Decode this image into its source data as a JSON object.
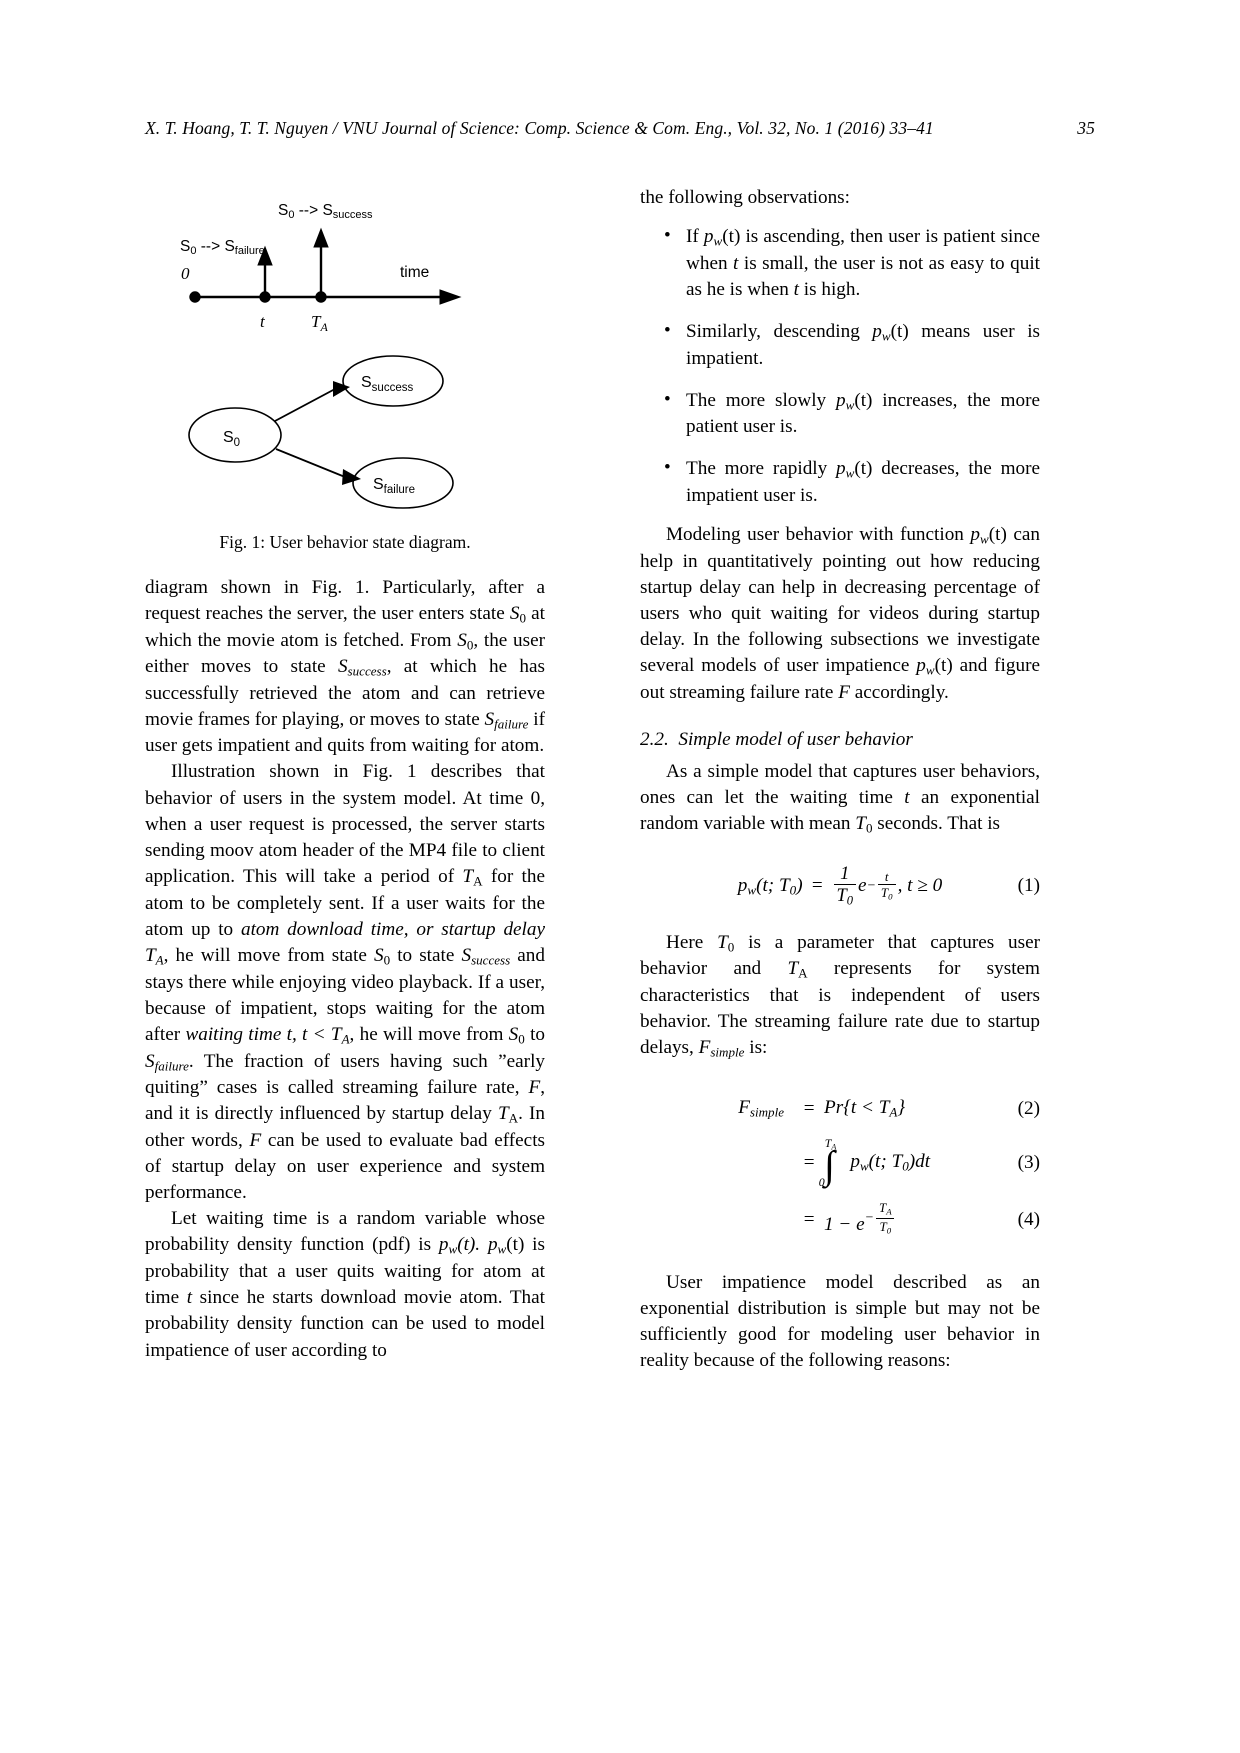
{
  "header": {
    "running_head": "X. T. Hoang, T. T. Nguyen / VNU Journal of Science: Comp. Science & Com. Eng., Vol. 32, No. 1 (2016) 33–41",
    "page_number": "35"
  },
  "figure": {
    "caption": "Fig. 1: User behavior state diagram.",
    "timeline": {
      "label_success": "S₀ --> S",
      "label_success_sub": "success",
      "label_failure": "S₀ --> S",
      "label_failure_sub": "failure",
      "origin_label": "0",
      "axis_label": "time",
      "tick_t": "t",
      "tick_ta": "T",
      "tick_ta_sub": "A"
    },
    "states": {
      "start": "S",
      "start_sub": "0",
      "success": "S",
      "success_sub": "success",
      "failure": "S",
      "failure_sub": "failure"
    }
  },
  "left_column": {
    "para1": {
      "part1": "diagram shown in Fig. 1. Particularly, after a request reaches the server, the user enters state ",
      "sym_s0_a": "S",
      "sub_0_a": "0",
      "part2": " at which the movie atom is fetched. From ",
      "sym_s0_b": "S",
      "sub_0_b": "0",
      "part3": ", the user either moves to state ",
      "sym_ssuccess": "S",
      "sub_success": "success",
      "part4": ", at which he has successfully retrieved the atom and can retrieve movie frames for playing, or moves to state ",
      "sym_sfailure": "S",
      "sub_failure": "failure",
      "part5": " if user gets impatient and quits from waiting for atom."
    },
    "para2": {
      "part1": "Illustration shown in Fig. 1 describes that behavior of users in the system model. At time 0, when a user request is processed, the server starts sending moov atom header of the MP4 file to client application. This will take a period of ",
      "sym_ta_a": "T",
      "sub_a_a": "A",
      "part2": " for the atom to be completely sent. If a user waits for the atom up to ",
      "em1": "atom download time, or startup delay T",
      "em1_sub": "A",
      "part3": ", he will move from state ",
      "sym_s0_a": "S",
      "sub_0_a": "0",
      "part4": " to state ",
      "sym_ssuccess": "S",
      "sub_success": "success",
      "part5": " and stays there while enjoying video playback. If a user, because of impatient, stops waiting for the atom after ",
      "em2": "waiting time t, t < T",
      "em2_sub": "A",
      "part6": ", he will move from ",
      "sym_s0_b": "S",
      "sub_0_b": "0",
      "part7": " to ",
      "sym_sfailure": "S",
      "sub_failure": "failure",
      "part8": ". The fraction of users having such ”early quiting” cases is called streaming failure rate, ",
      "sym_f_a": "F",
      "part9": ", and it is directly influenced by startup delay ",
      "sym_ta_b": "T",
      "sub_a_b": "A",
      "part10": ". In other words, ",
      "sym_f_b": "F",
      "part11": " can be used to evaluate bad effects of startup delay on user experience and system performance."
    },
    "para3": {
      "part1": "Let waiting time is a random variable whose probability density function (pdf) is ",
      "sym_pw_a": "p",
      "sub_w_a": "w",
      "part2": "(t). ",
      "sym_pw_b": "p",
      "sub_w_b": "w",
      "part3": "(t) is probability that a user quits waiting for atom at time ",
      "sym_t": "t",
      "part4": " since he starts download movie atom. That probability density function can be used to model impatience of user according to"
    }
  },
  "right_column": {
    "lead": "the following observations:",
    "bullet_marker": "•",
    "observations": [
      {
        "part1": "If ",
        "sym_p": "p",
        "sym_sub": "w",
        "part2": "(t) is ascending, then user is patient since when ",
        "sym_t1": "t",
        "part3": " is small, the user is not as easy to quit as he is when ",
        "sym_t2": "t",
        "part4": " is high."
      },
      {
        "part1": "Similarly, descending ",
        "sym_p": "p",
        "sym_sub": "w",
        "part2": "(t) means user is impatient.",
        "sym_t1": "",
        "part3": "",
        "sym_t2": "",
        "part4": ""
      },
      {
        "part1": "The more slowly ",
        "sym_p": "p",
        "sym_sub": "w",
        "part2": "(t) increases, the more patient user is.",
        "sym_t1": "",
        "part3": "",
        "sym_t2": "",
        "part4": ""
      },
      {
        "part1": "The more rapidly ",
        "sym_p": "p",
        "sym_sub": "w",
        "part2": "(t) decreases, the more impatient user is.",
        "sym_t1": "",
        "part3": "",
        "sym_t2": "",
        "part4": ""
      }
    ],
    "para_model": {
      "part1": "Modeling user behavior with function ",
      "sym_p": "p",
      "sym_sub": "w",
      "part2": "(t) can help in quantitatively pointing out how reducing startup delay can help in decreasing percentage of users who quit waiting for videos during startup delay. In the following subsections we investigate several models of user impatience ",
      "sym_p2": "p",
      "sym_sub2": "w",
      "part3": "(t) and figure out streaming failure rate ",
      "sym_f": "F",
      "part4": " accordingly."
    },
    "subsection": {
      "number": "2.2.",
      "title": "Simple model of user behavior"
    },
    "para_simple": {
      "part1": "As a simple model that captures user behaviors, ones can let the waiting time ",
      "sym_t": "t",
      "part2": " an exponential random variable with mean ",
      "sym_t0": "T",
      "sub_0": "0",
      "part3": " seconds. That is"
    },
    "para_here": {
      "part1": "Here ",
      "sym_t0": "T",
      "sub_0": "0",
      "part2": " is a parameter that captures user behavior and ",
      "sym_ta": "T",
      "sub_a": "A",
      "part3": " represents for system characteristics that is independent of users behavior. The streaming failure rate due to startup delays, ",
      "sym_f": "F",
      "sub_simple": "simple",
      "part4": " is:"
    },
    "para_tail": "User impatience model described as an exponential distribution is simple but may not be sufficiently good for modeling user behavior in reality because of the following reasons:",
    "equations": {
      "eq1": {
        "number": "(1)",
        "lhs_p": "p",
        "lhs_sub": "w",
        "lhs_args": "(t; T",
        "lhs_args_sub": "0",
        "lhs_close": ")",
        "eq": "=",
        "frac_num": "1",
        "frac_den": "T",
        "frac_den_sub": "0",
        "e": "e",
        "exp_minus": "−",
        "exp_num": "t",
        "exp_den": "T",
        "exp_den_sub": "0",
        "tail": ", t ≥ 0"
      },
      "eq2": {
        "number": "(2)",
        "lhs": "F",
        "lhs_sub": "simple",
        "eq": "=",
        "rhs": "Pr{t < T",
        "rhs_sub": "A",
        "rhs_close": "}"
      },
      "eq3": {
        "number": "(3)",
        "eq": "=",
        "int_upper": "T",
        "int_upper_sub": "A",
        "int_lower": "0",
        "rhs_p": "p",
        "rhs_sub": "w",
        "rhs_args": "(t; T",
        "rhs_args_sub": "0",
        "rhs_close": ")dt"
      },
      "eq4": {
        "number": "(4)",
        "eq": "=",
        "rhs_one": "1 − ",
        "e": "e",
        "exp_minus": "−",
        "exp_num": "T",
        "exp_num_sub": "A",
        "exp_den": "T",
        "exp_den_sub": "0"
      }
    }
  }
}
